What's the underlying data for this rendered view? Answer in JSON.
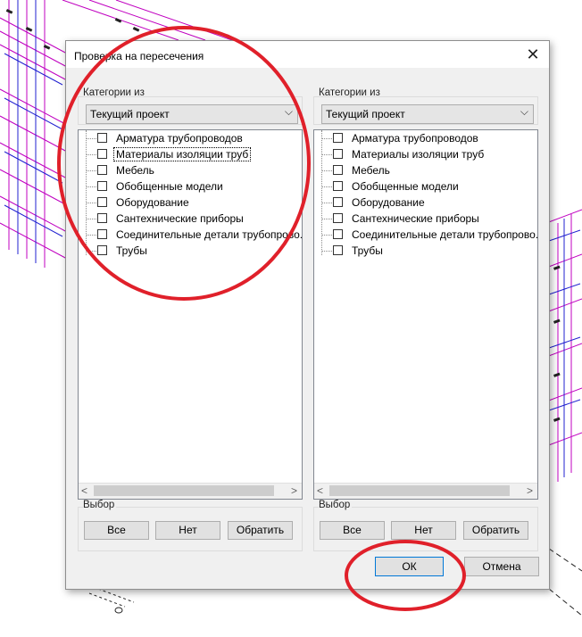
{
  "dialog": {
    "title": "Проверка на пересечения",
    "close_glyph": "✕"
  },
  "left": {
    "categories_label": "Категории из",
    "combo_value": "Текущий проект",
    "items": [
      {
        "label": "Арматура трубопроводов",
        "checked": false
      },
      {
        "label": "Материалы изоляции труб",
        "checked": false
      },
      {
        "label": "Мебель",
        "checked": false
      },
      {
        "label": "Обобщенные модели",
        "checked": false
      },
      {
        "label": "Оборудование",
        "checked": false
      },
      {
        "label": "Сантехнические приборы",
        "checked": false
      },
      {
        "label": "Соединительные детали трубопрово...",
        "checked": false
      },
      {
        "label": "Трубы",
        "checked": false
      }
    ],
    "selection_label": "Выбор",
    "btn_all": "Все",
    "btn_none": "Нет",
    "btn_invert": "Обратить"
  },
  "right": {
    "categories_label": "Категории из",
    "combo_value": "Текущий проект",
    "items": [
      {
        "label": "Арматура трубопроводов",
        "checked": false
      },
      {
        "label": "Материалы изоляции труб",
        "checked": false
      },
      {
        "label": "Мебель",
        "checked": false
      },
      {
        "label": "Обобщенные модели",
        "checked": false
      },
      {
        "label": "Оборудование",
        "checked": false
      },
      {
        "label": "Сантехнические приборы",
        "checked": false
      },
      {
        "label": "Соединительные детали трубопрово...",
        "checked": false
      },
      {
        "label": "Трубы",
        "checked": false
      }
    ],
    "selection_label": "Выбор",
    "btn_all": "Все",
    "btn_none": "Нет",
    "btn_invert": "Обратить"
  },
  "footer": {
    "ok_label": "ОК",
    "cancel_label": "Отмена"
  },
  "colors": {
    "annotation": "#e0202a",
    "cad_magenta": "#c000c0",
    "cad_blue": "#2020d0"
  }
}
